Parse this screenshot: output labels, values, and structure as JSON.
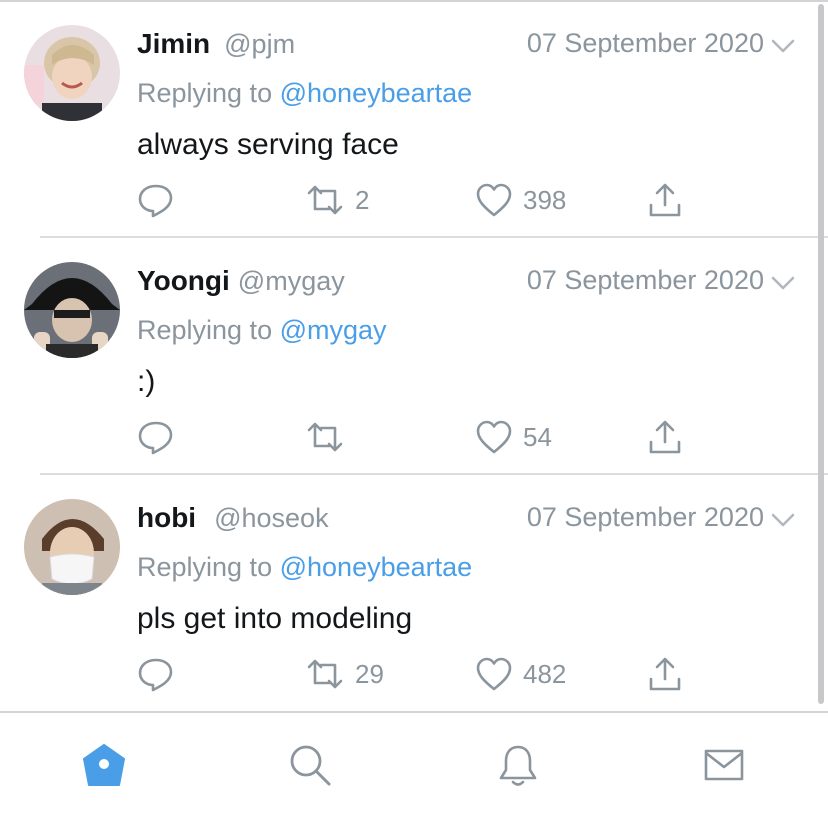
{
  "tweets": [
    {
      "name": "Jimin",
      "handle": "@pjm",
      "date": "07 September 2020",
      "replying_prefix": "Replying to",
      "replying_to": "@honeybeartae",
      "text": "always serving face",
      "retweets": "2",
      "likes": "398"
    },
    {
      "name": "Yoongi",
      "handle": "@mygay",
      "date": "07 September 2020",
      "replying_prefix": "Replying to",
      "replying_to": "@mygay",
      "text": ":)",
      "retweets": "",
      "likes": "54"
    },
    {
      "name": "hobi",
      "handle": "@hoseok",
      "date": "07 September 2020",
      "replying_prefix": "Replying to",
      "replying_to": "@honeybeartae",
      "text": "pls get into modeling",
      "retweets": "29",
      "likes": "482"
    }
  ],
  "tab_bar": {
    "icons": [
      "home-icon",
      "search-icon",
      "bell-icon",
      "mail-icon"
    ],
    "active": "home-icon"
  },
  "colors": {
    "accent": "#4a9ee8",
    "muted": "#8b959e",
    "text": "#14171a",
    "icon": "#8b959e"
  }
}
